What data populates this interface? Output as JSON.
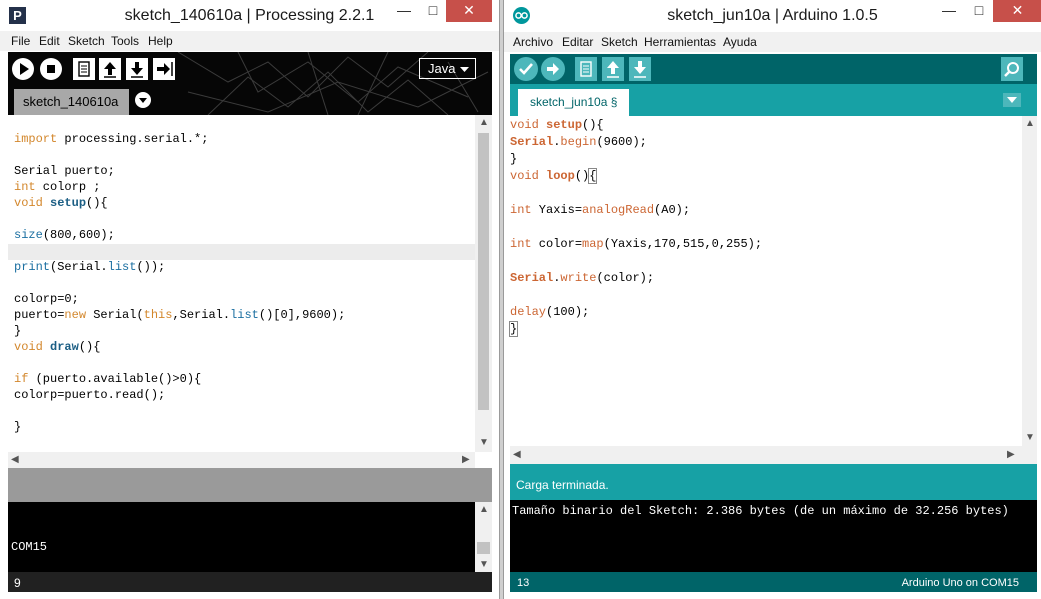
{
  "processing": {
    "title": "sketch_140610a | Processing 2.2.1",
    "app_icon_letter": "P",
    "menu": [
      "File",
      "Edit",
      "Sketch",
      "Tools",
      "Help"
    ],
    "mode": "Java",
    "tab": "sketch_140610a",
    "code": [
      "import processing.serial.*;",
      "",
      "Serial puerto;",
      "int colorp ;",
      "void setup(){",
      "",
      "size(800,600);",
      "",
      "print(Serial.list());",
      "",
      "colorp=0;",
      "puerto=new Serial(this,Serial.list()[0],9600);",
      "}",
      "void draw(){",
      "",
      "if (puerto.available()>0){",
      "colorp=puerto.read();",
      "",
      "}"
    ],
    "console_text": "COM15",
    "line_number": "9"
  },
  "arduino": {
    "title": "sketch_jun10a | Arduino 1.0.5",
    "menu": [
      "Archivo",
      "Editar",
      "Sketch",
      "Herramientas",
      "Ayuda"
    ],
    "tab": "sketch_jun10a §",
    "code": [
      "void setup(){",
      "Serial.begin(9600);",
      "}",
      "void loop(){",
      "",
      "int Yaxis=analogRead(A0);",
      "",
      "int color=map(Yaxis,170,515,0,255);",
      "",
      "Serial.write(color);",
      "",
      "delay(100);",
      "}"
    ],
    "status": "Carga terminada.",
    "console_text": "Tamaño binario del Sketch: 2.386 bytes (de un máximo de 32.256 bytes)",
    "line_number": "13",
    "board": "Arduino Uno on COM15"
  },
  "window_controls": {
    "minimize": "—",
    "maximize": "□",
    "close": "✕"
  },
  "colors": {
    "processing_toolbar": "#060606",
    "processing_tab": "#a8a8a8",
    "arduino_teal_dark": "#006468",
    "arduino_teal": "#17a1a5",
    "arduino_button": "#4db7bb"
  }
}
